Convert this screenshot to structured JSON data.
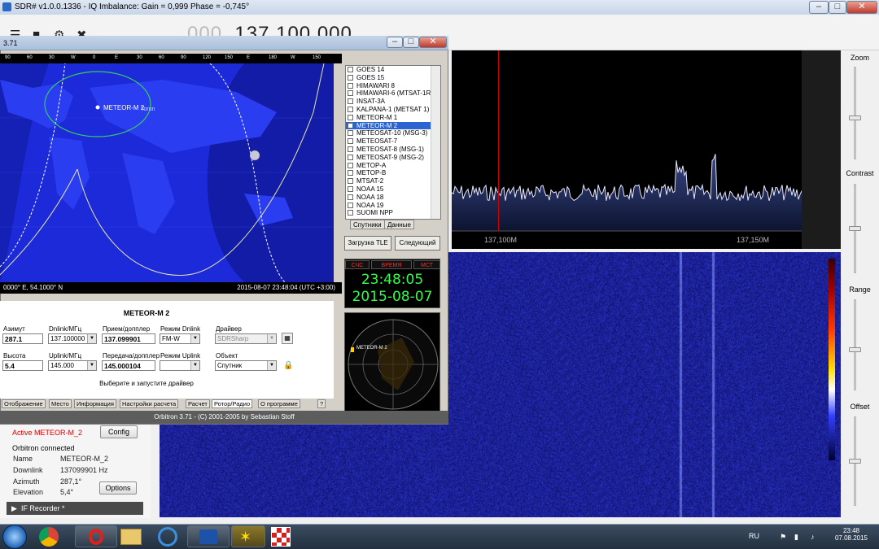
{
  "sdr": {
    "title": "SDR# v1.0.0.1336 - IQ Imbalance: Gain = 0,999 Phase = -0,745°",
    "freq_dim": "000.",
    "freq_main": "137.100.000",
    "spectrum_labels": [
      "137,100M",
      "137,150M"
    ],
    "right_panel": {
      "zoom": "Zoom",
      "contrast": "Contrast",
      "range": "Range",
      "offset": "Offset"
    },
    "zoom_level": 0.45,
    "contrast_level": 0.5,
    "range_level": 0.45,
    "offset_level": 0.5,
    "left_panel": {
      "active": "Active METEOR-M_2",
      "config": "Config",
      "connected": "Orbitron connected",
      "rows": [
        {
          "key": "Name",
          "value": "METEOR-M_2"
        },
        {
          "key": "Downlink",
          "value": "137099901 Hz"
        },
        {
          "key": "Azimuth",
          "value": "287,1°"
        },
        {
          "key": "Elevation",
          "value": "5,4°"
        }
      ],
      "options": "Options",
      "if_recorder": "IF Recorder *"
    }
  },
  "orbitron": {
    "title": "3.71",
    "map_ticks": [
      "90",
      "60",
      "30",
      "W",
      "0",
      "E",
      "30",
      "60",
      "90",
      "120",
      "150",
      "E",
      "180",
      "W",
      "150"
    ],
    "sat_label": "METEOR-M 2",
    "place_label": "Torun",
    "coords": "0000° E, 54.1000° N",
    "datetime": "2015-08-07 23:48:04 (UTC +3:00)",
    "satellites": [
      {
        "name": "GOES 14",
        "checked": false
      },
      {
        "name": "GOES 15",
        "checked": false
      },
      {
        "name": "HIMAWARI 8",
        "checked": false
      },
      {
        "name": "HIMAWARI-6 (MTSAT-1R)",
        "checked": false
      },
      {
        "name": "INSAT-3A",
        "checked": false
      },
      {
        "name": "KALPANA-1 (METSAT 1)",
        "checked": false
      },
      {
        "name": "METEOR-M 1",
        "checked": false
      },
      {
        "name": "METEOR-M 2",
        "checked": true
      },
      {
        "name": "METEOSAT-10 (MSG-3)",
        "checked": false
      },
      {
        "name": "METEOSAT-7",
        "checked": false
      },
      {
        "name": "METEOSAT-8 (MSG-1)",
        "checked": false
      },
      {
        "name": "METEOSAT-9 (MSG-2)",
        "checked": false
      },
      {
        "name": "METOP-A",
        "checked": false
      },
      {
        "name": "METOP-B",
        "checked": false
      },
      {
        "name": "MTSAT-2",
        "checked": false
      },
      {
        "name": "NOAA 15",
        "checked": false
      },
      {
        "name": "NOAA 18",
        "checked": false
      },
      {
        "name": "NOAA 19",
        "checked": false
      },
      {
        "name": "SUOMI NPP",
        "checked": false
      }
    ],
    "list_tabs": [
      "Спутники",
      "Данные"
    ],
    "btn_tle": "Загрузка TLE",
    "btn_next": "Следующий",
    "clock_heads": [
      "СЧС",
      "ВРЕМЯ",
      "МСТ"
    ],
    "clock_time": "23:48:05",
    "clock_date": "2015-08-07",
    "radar_label": "METEOR-M 2",
    "panel": {
      "sat_title": "METEOR-M 2",
      "azimuth_label": "Азимут",
      "azimuth": "287.1",
      "altitude_label": "Высота",
      "altitude": "5.4",
      "dnlink_label": "Dnlink/МГц",
      "dnlink": "137.100000",
      "uplink_label": "Uplink/МГц",
      "uplink": "145.000",
      "rx_label": "Прием/допплер",
      "rx": "137.099901",
      "tx_label": "Передача/допплер",
      "tx": "145.000104",
      "mode_dn_label": "Режим Dnlink",
      "mode_dn": "FM-W",
      "mode_up_label": "Режим Uplink",
      "mode_up": "",
      "driver_label": "Драйвер",
      "driver": "SDRSharp",
      "object_label": "Объект",
      "object": "Спутник",
      "hint": "Выберите и запустите драйвер"
    },
    "tabs": [
      "Отображение",
      "Место",
      "Информация",
      "Настройки расчета",
      "Расчет",
      "Ротор/Радио",
      "О программе",
      "?"
    ],
    "status": "Orbitron 3.71 - (C) 2001-2005 by Sebastian Stoff"
  },
  "taskbar": {
    "lang": "RU",
    "time": "23:48",
    "date": "07.08.2015"
  }
}
